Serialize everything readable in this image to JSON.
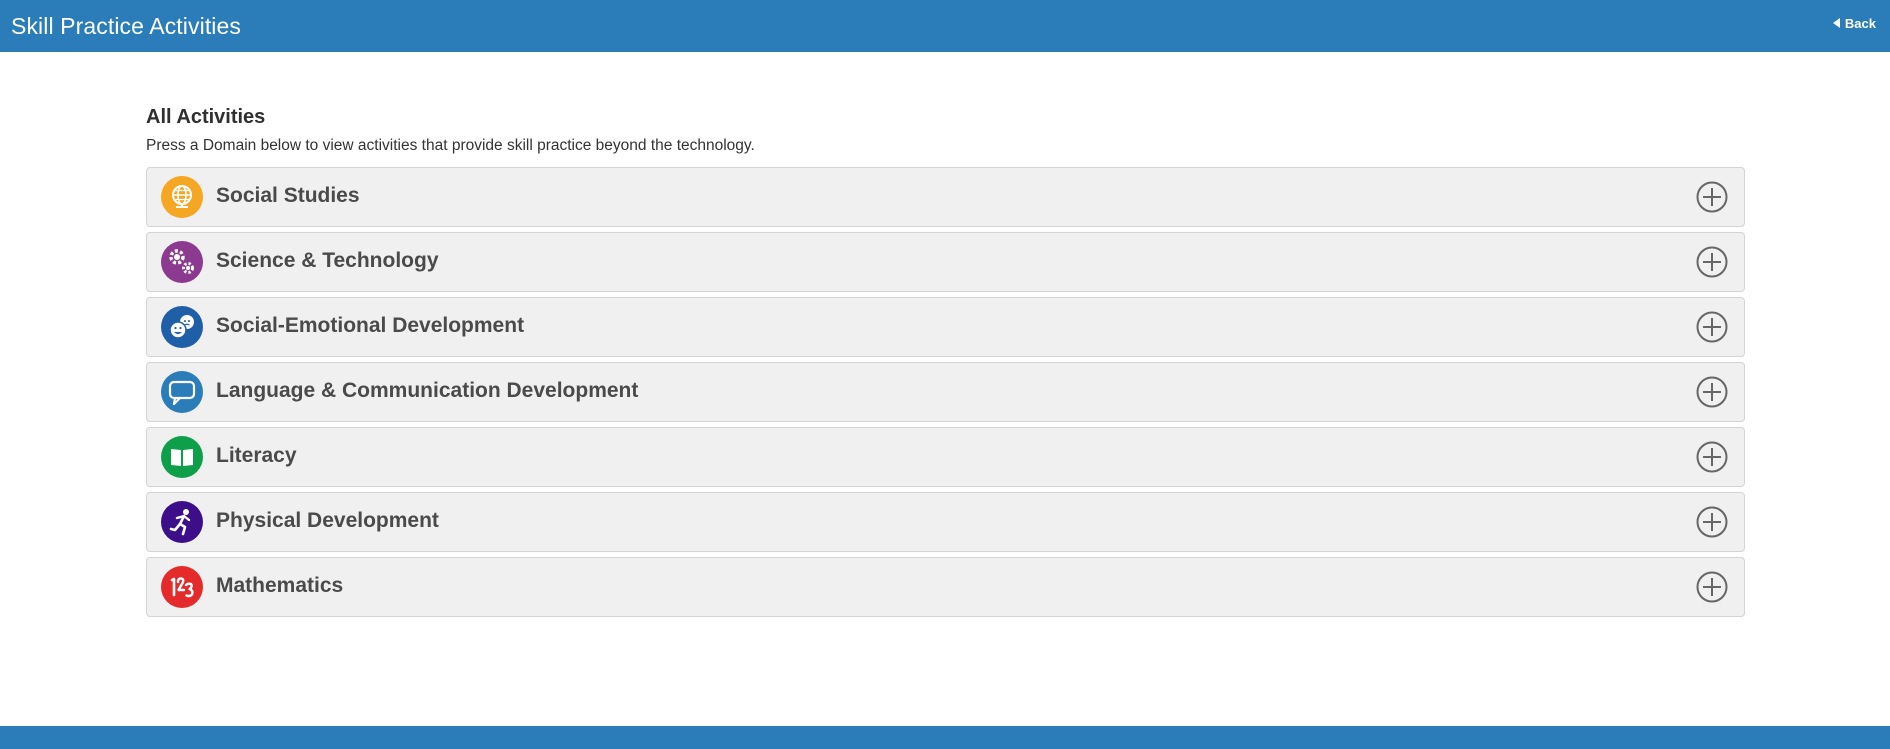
{
  "header": {
    "title": "Skill Practice Activities",
    "back_label": "Back"
  },
  "main": {
    "section_title": "All Activities",
    "description": "Press a Domain below to view activities that provide skill practice beyond the technology.",
    "domains": [
      {
        "label": "Social Studies",
        "icon": "globe-icon",
        "color": "#f5a623"
      },
      {
        "label": "Science & Technology",
        "icon": "gears-icon",
        "color": "#8b3a8f"
      },
      {
        "label": "Social-Emotional Development",
        "icon": "faces-icon",
        "color": "#1f5fa8"
      },
      {
        "label": "Language & Communication Development",
        "icon": "speech-bubble-icon",
        "color": "#2a7db8"
      },
      {
        "label": "Literacy",
        "icon": "book-icon",
        "color": "#0e9f4b"
      },
      {
        "label": "Physical Development",
        "icon": "running-figure-icon",
        "color": "#3d0e8a"
      },
      {
        "label": "Mathematics",
        "icon": "numbers-icon",
        "color": "#e42a2a"
      }
    ]
  },
  "colors": {
    "header_bg": "#2a7db8",
    "row_bg": "#f0f0f0",
    "row_border": "#d4d4d4",
    "label_text": "#4a4a4a"
  }
}
